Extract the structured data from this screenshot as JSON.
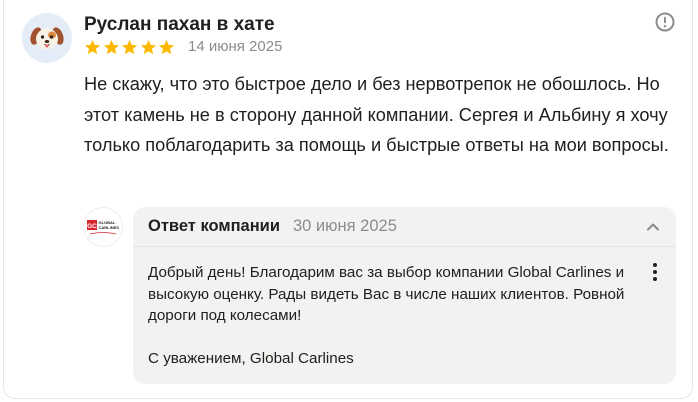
{
  "review": {
    "author": "Руслан пахан в хате",
    "rating": 5,
    "max_rating": 5,
    "date": "14 июня 2025",
    "text": "Не скажу, что это быстрое дело и без нервотрепок не обошлось. Но этот камень не в сторону данной компании. Сергея и Альбину я хочу только поблагодарить за помощь и быстрые ответы на мои вопросы."
  },
  "reply": {
    "title": "Ответ компании",
    "date": "30 июня 2025",
    "paragraph1": "Добрый день! Благодарим вас за выбор компании Global Carlines и высокую оценку. Рады видеть Вас в числе наших клиентов. Ровной дороги под колесами!",
    "paragraph2": "С уважением, Global Carlines",
    "logo_text": [
      "GLOBAL",
      "CARLINES"
    ],
    "logo_mark": "GC"
  },
  "colors": {
    "star": "#ffb800",
    "muted": "#8c8c8c",
    "reply_bg": "#f2f2f0",
    "logo_red": "#d7262e"
  },
  "icons": {
    "report": "exclamation-circle-icon",
    "collapse": "chevron-up-icon",
    "more": "vertical-dots-icon"
  }
}
